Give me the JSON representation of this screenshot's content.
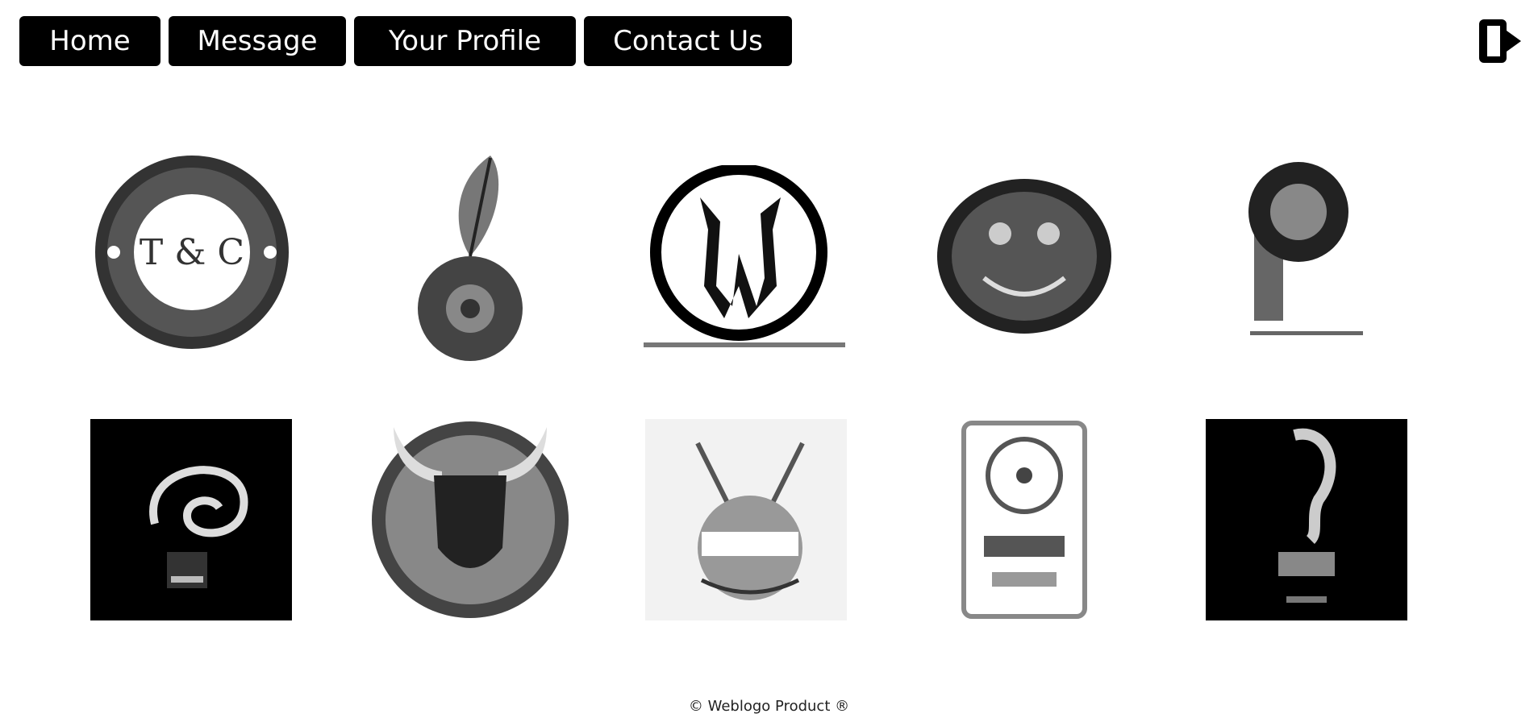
{
  "nav": {
    "items": [
      {
        "label": "Home"
      },
      {
        "label": "Message"
      },
      {
        "label": "Your Profile"
      },
      {
        "label": "Contact Us"
      }
    ]
  },
  "header": {
    "logout_icon": "logout-icon"
  },
  "gallery": {
    "logos": [
      {
        "name": "logo-tc-badge",
        "text": "T & C"
      },
      {
        "name": "logo-feather-circle",
        "text": ""
      },
      {
        "name": "logo-tribal-circle",
        "text": ""
      },
      {
        "name": "logo-oval-emblem",
        "text": ""
      },
      {
        "name": "logo-letter-p",
        "text": ""
      },
      {
        "name": "logo-bulb-swirl",
        "text": ""
      },
      {
        "name": "logo-bull-head",
        "text": ""
      },
      {
        "name": "logo-bug-mask",
        "text": ""
      },
      {
        "name": "logo-framed-seal",
        "text": ""
      },
      {
        "name": "logo-black-square-figure",
        "text": ""
      }
    ]
  },
  "footer": {
    "text": "© Weblogo Product ®"
  },
  "colors": {
    "nav_bg": "#000000",
    "nav_text": "#ffffff",
    "page_bg": "#ffffff"
  }
}
